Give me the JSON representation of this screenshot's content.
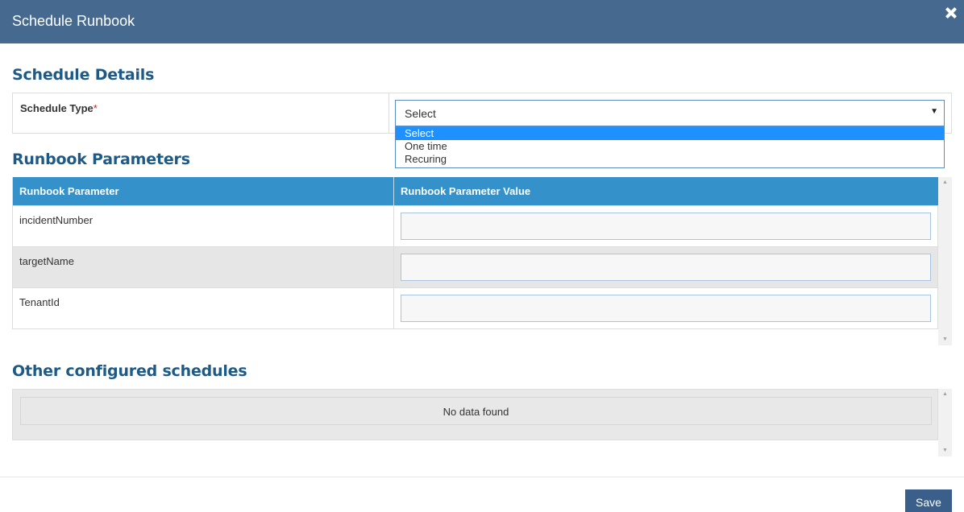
{
  "modal": {
    "title": "Schedule Runbook"
  },
  "schedule_details": {
    "heading": "Schedule Details",
    "type_label": "Schedule Type",
    "required_mark": "*",
    "select_value": "Select",
    "options": [
      "Select",
      "One time",
      "Recuring"
    ],
    "selected_option": "Select"
  },
  "runbook_parameters": {
    "heading": "Runbook Parameters",
    "columns": [
      "Runbook Parameter",
      "Runbook Parameter Value"
    ],
    "rows": [
      {
        "name": "incidentNumber",
        "value": ""
      },
      {
        "name": "targetName",
        "value": ""
      },
      {
        "name": "TenantId",
        "value": ""
      }
    ]
  },
  "other_schedules": {
    "heading": "Other configured schedules",
    "empty_text": "No data found"
  },
  "footer": {
    "save_label": "Save"
  },
  "icons": {
    "close": "close-icon",
    "caret": "caret-down-icon",
    "scroll_up": "scroll-up-arrow-icon",
    "scroll_down": "scroll-down-arrow-icon"
  },
  "colors": {
    "header_bg": "#45698f",
    "table_header_bg": "#3591c9",
    "heading_text": "#1e5a86",
    "dropdown_highlight": "#1e90ff",
    "save_bg": "#3a5f8a"
  }
}
